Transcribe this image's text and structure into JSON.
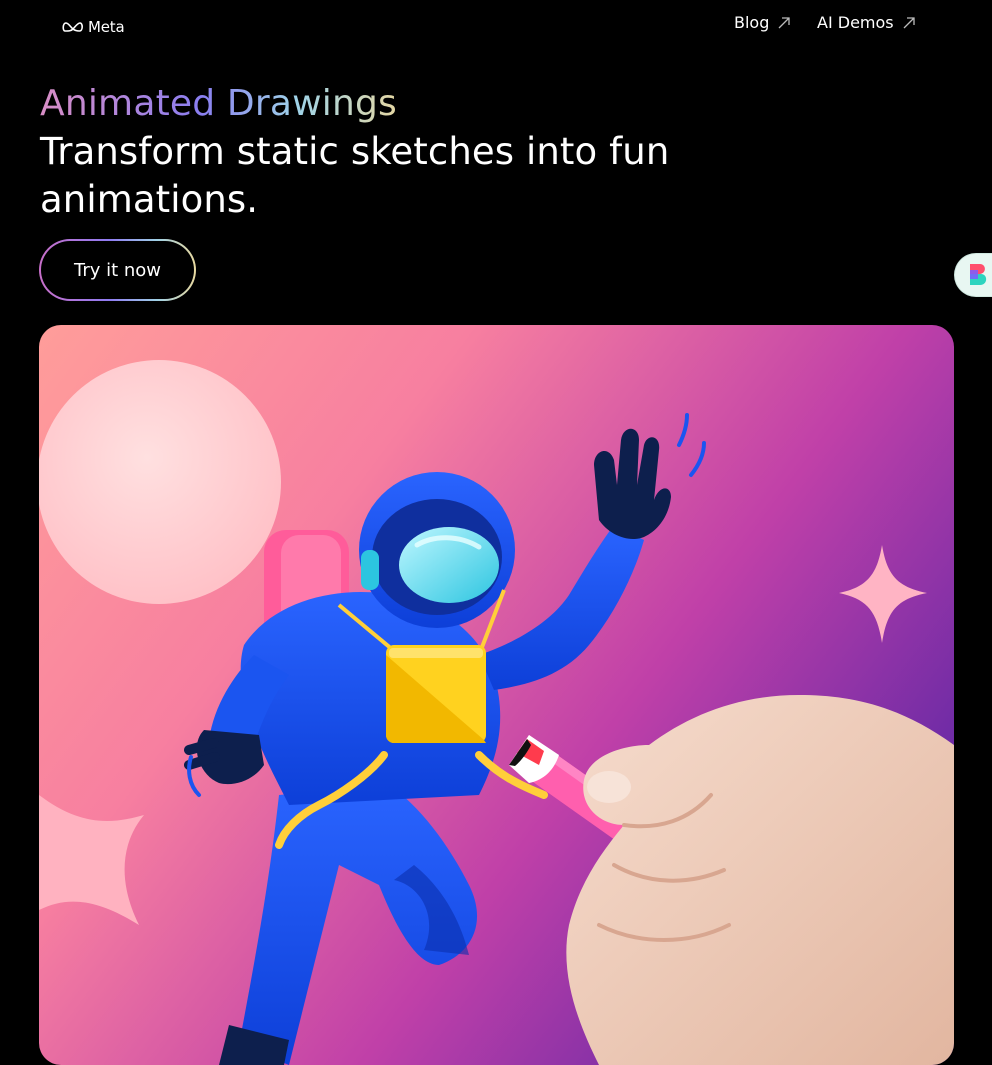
{
  "header": {
    "brand": "Meta",
    "nav": [
      {
        "label": "Blog"
      },
      {
        "label": "AI Demos"
      }
    ]
  },
  "hero": {
    "eyebrow": "Animated Drawings",
    "headline": "Transform static sketches into fun animations.",
    "cta_label": "Try it now"
  },
  "icons": {
    "brand_logo": "meta-infinity-icon",
    "nav_arrow": "arrow-up-right-icon",
    "side_widget": "extension-logo-icon"
  },
  "colors": {
    "background": "#000000",
    "text": "#ffffff",
    "gradient": [
      "#d98ec6",
      "#8a7ef0",
      "#9fd3e8",
      "#e4d7a4"
    ]
  }
}
